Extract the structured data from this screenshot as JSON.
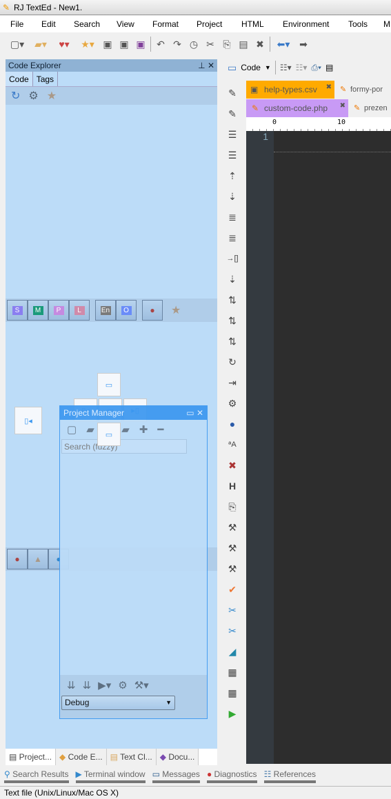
{
  "window": {
    "title": "RJ TextEd - New1."
  },
  "menu": [
    "File",
    "Edit",
    "Search",
    "View",
    "Format",
    "Project",
    "HTML",
    "Environment",
    "Tools",
    "M"
  ],
  "toolbar": {
    "icons": [
      "new-file-icon",
      "open-folder-icon",
      "favorites-folder-icon",
      "star-icon",
      "save-icon",
      "save-all-icon",
      "save-as-icon",
      "undo-icon",
      "redo-icon",
      "history-icon",
      "cut-icon",
      "copy-icon",
      "paste-icon",
      "delete-icon",
      "back-arrow-icon",
      "forward-arrow-icon"
    ]
  },
  "code_explorer": {
    "title": "Code Explorer",
    "tabs": [
      "Code",
      "Tags"
    ]
  },
  "filter_strip": [
    "S",
    "M",
    "P",
    "L",
    "En",
    "O"
  ],
  "filter_colors": [
    "#8a7ef0",
    "#1a9a7a",
    "#c58ae0",
    "#d08aaa",
    "#7a7a7a",
    "#6a8cf8"
  ],
  "project_manager": {
    "title": "Project Manager",
    "search_placeholder": "Search (fuzzy)",
    "config": "Debug"
  },
  "editor": {
    "view_mode": "Code",
    "tabs_row1": [
      "help-types.csv",
      "formy-por"
    ],
    "tabs_row2": [
      "custom-code.php",
      "prezen"
    ],
    "ruler": [
      "0",
      "10"
    ],
    "line_numbers": [
      "1"
    ],
    "active_colors": {
      "csv": "#ffaa00",
      "php": "#c89af5"
    }
  },
  "bottom_tabs": [
    "Project...",
    "Code E...",
    "Text Cl...",
    "Docu..."
  ],
  "lower_tabs": [
    "Search Results",
    "Terminal window",
    "Messages",
    "Diagnostics",
    "References"
  ],
  "status": {
    "text": "Text file (Unix/Linux/Mac OS X)"
  }
}
